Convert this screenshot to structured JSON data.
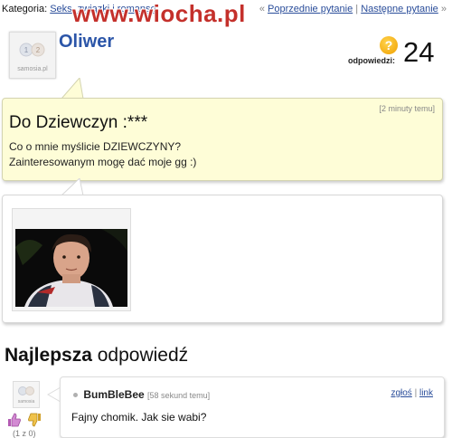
{
  "topbar": {
    "category_label": "Kategoria:",
    "category_link": "Seks, związki i romanse",
    "prev_question": "Poprzednie pytanie",
    "separator": "|",
    "next_question": "Następne pytanie",
    "prev_arrow": "«",
    "next_arrow": "»"
  },
  "watermark": {
    "text": "www.wiocha.pl"
  },
  "asker": {
    "avatar_caption": "samosia.pl",
    "username": "Oliwer"
  },
  "answers": {
    "icon": "question-bulb-icon",
    "icon_glyph": "?",
    "label": "odpowiedzi:",
    "count": "24"
  },
  "question": {
    "time": "[2 minuty temu]",
    "title": "Do Dziewczyn :***",
    "body_line1": "Co o mnie myślicie DZIEWCZYNY?",
    "body_line2": "Zainteresowanym mogę dać moje gg :)"
  },
  "best_answer": {
    "heading_bold": "Najlepsza",
    "heading_rest": "odpowiedź",
    "avatar_caption": "samosia",
    "user": "BumBleBee",
    "time": "[58 sekund temu]",
    "report_link": "zgłoś",
    "separator": "|",
    "link_link": "link",
    "text": "Fajny chomik. Jak sie wabi?",
    "votes": "(1 z 0)"
  },
  "colors": {
    "accent_blue": "#2b55a8",
    "question_bg": "#fefdd7",
    "watermark_red": "#c4302b"
  }
}
